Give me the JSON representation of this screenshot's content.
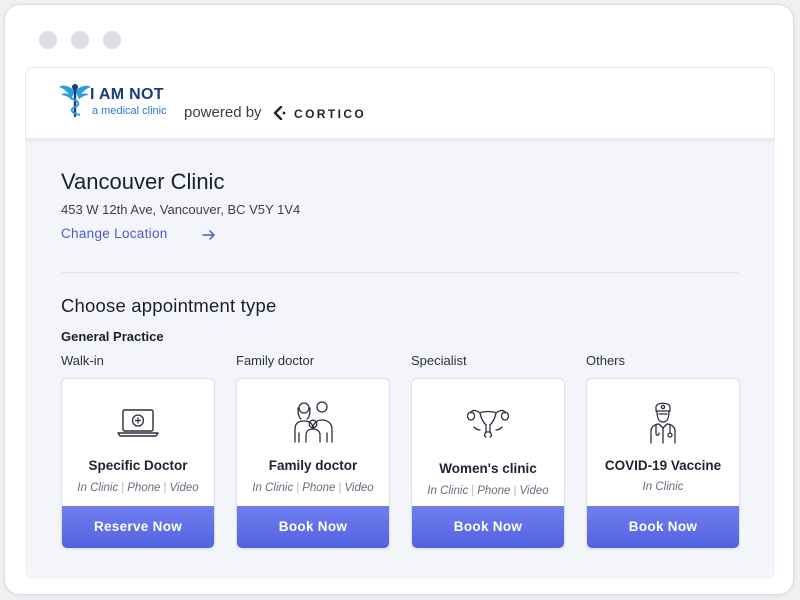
{
  "header": {
    "brand_line1": "I AM NOT",
    "brand_line2": "a medical clinic",
    "powered_by": "powered by",
    "cortico": "CORTICO"
  },
  "clinic": {
    "name": "Vancouver Clinic",
    "address": "453 W 12th Ave, Vancouver, BC V5Y 1V4",
    "change_location": "Change Location"
  },
  "appointments": {
    "title": "Choose appointment type",
    "group": "General Practice",
    "columns": [
      {
        "label": "Walk-in",
        "icon": "laptop-icon",
        "card_title": "Specific Doctor",
        "modes": [
          "In Clinic",
          "Phone",
          "Video"
        ],
        "button": "Reserve Now"
      },
      {
        "label": "Family doctor",
        "icon": "family-icon",
        "card_title": "Family doctor",
        "modes": [
          "In Clinic",
          "Phone",
          "Video"
        ],
        "button": "Book Now"
      },
      {
        "label": "Specialist",
        "icon": "uterus-icon",
        "card_title": "Women's clinic",
        "modes": [
          "In Clinic",
          "Phone",
          "Video"
        ],
        "button": "Book Now"
      },
      {
        "label": "Others",
        "icon": "doctor-icon",
        "card_title": "COVID-19 Vaccine",
        "modes": [
          "In Clinic"
        ],
        "button": "Book Now"
      }
    ]
  },
  "colors": {
    "accent": "#5162e0",
    "link": "#4a5cc9",
    "brand_navy": "#1b3e7a",
    "brand_blue": "#2a7bd6"
  }
}
